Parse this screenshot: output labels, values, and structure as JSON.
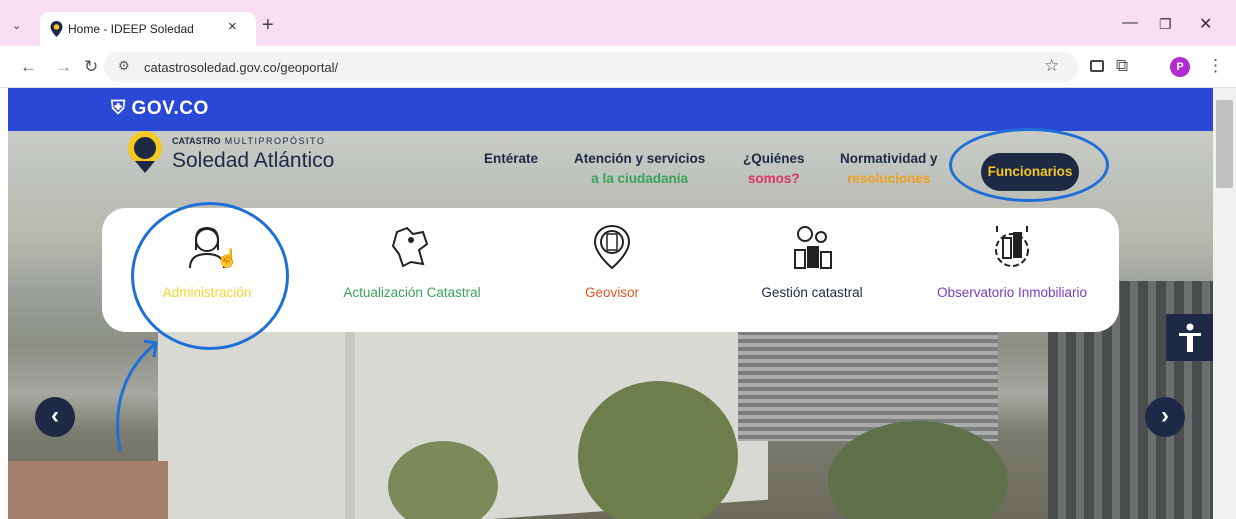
{
  "browser": {
    "tab_title": "Home - IDEEP Soledad",
    "tab_close": "×",
    "new_tab": "+",
    "url": "catastrosoledad.gov.co/geoportal/",
    "profile_initial": "P",
    "accent": "#f9dff3"
  },
  "site": {
    "gov_logo": "GOV.CO",
    "logo_line1_bold": "CATASTRO",
    "logo_line1_rest": "MULTIPROPÓSITO",
    "logo_line2": "Soledad Atlántico",
    "nav": [
      {
        "line1": "Entérate",
        "line2": ""
      },
      {
        "line1": "Atención y servicios",
        "line2": "a la ciudadanía",
        "line2_color": "#3aa35b"
      },
      {
        "line1": "¿Quiénes",
        "line2": "somos?",
        "line2_color": "#e0306b"
      },
      {
        "line1": "Normatividad y",
        "line2": "resoluciones",
        "line2_color": "#f0a020"
      }
    ],
    "cta": "Funcionarios",
    "cards": [
      {
        "label": "Administración",
        "color": "#f4d430",
        "icon": "woman-user-icon"
      },
      {
        "label": "Actualización Catastral",
        "color": "#3aa35b",
        "icon": "map-region-icon"
      },
      {
        "label": "Geovisor",
        "color": "#e0561f",
        "icon": "map-pin-building-icon"
      },
      {
        "label": "Gestión catastral",
        "color": "#1e2a45",
        "icon": "location-buildings-icon"
      },
      {
        "label": "Observatorio Inmobiliario",
        "color": "#7b3cc4",
        "icon": "gear-buildings-icon"
      }
    ],
    "brand_navy": "#1e2a45",
    "gov_blue": "#2948d6",
    "highlight_blue": "#1f6fd9"
  }
}
